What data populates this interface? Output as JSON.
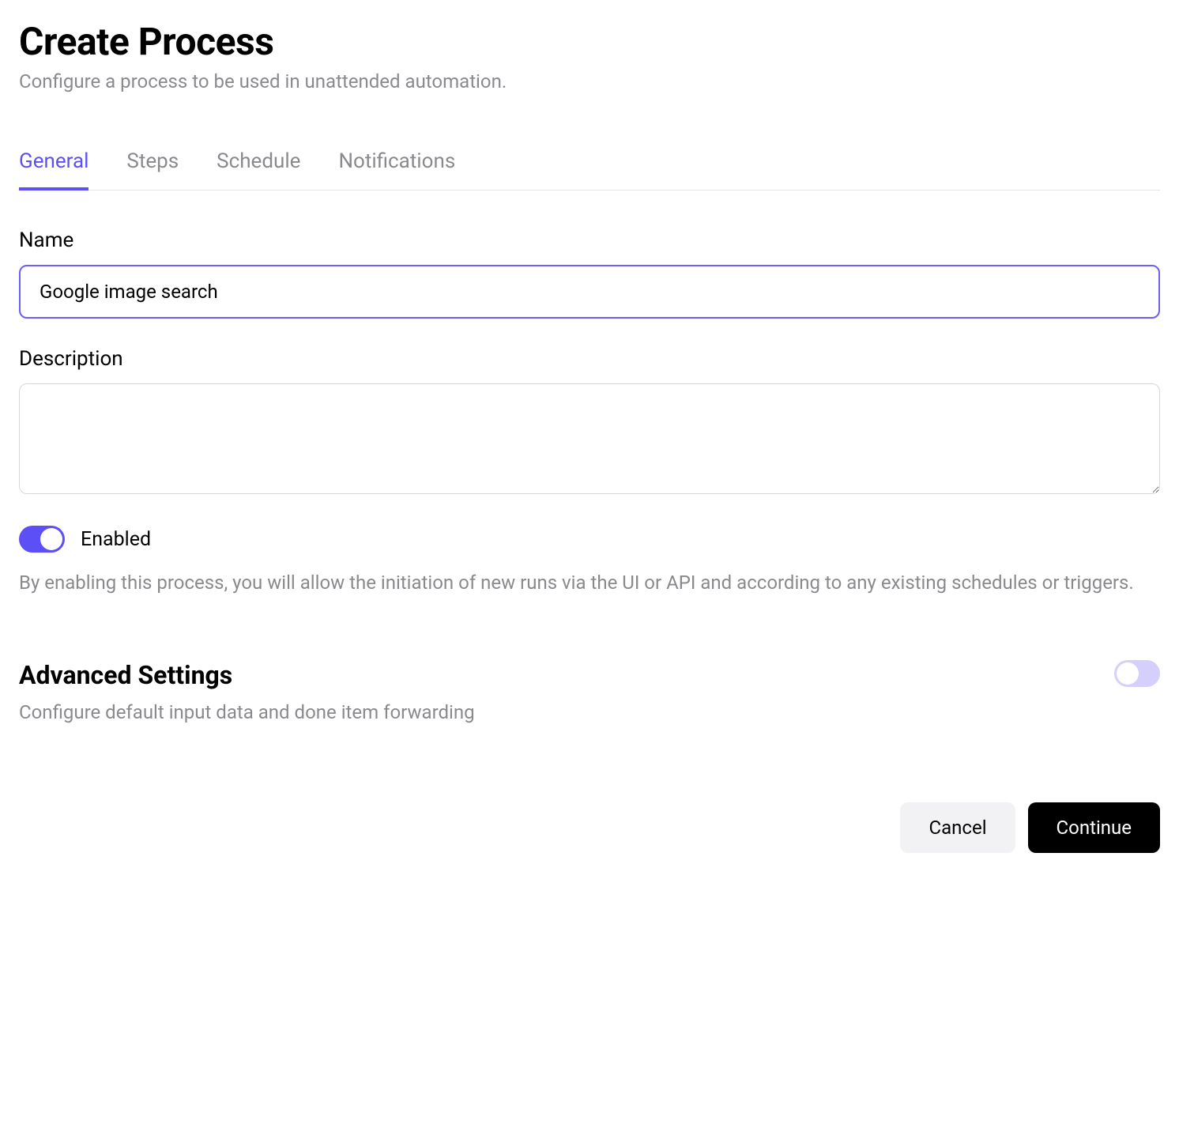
{
  "header": {
    "title": "Create Process",
    "subtitle": "Configure a process to be used in unattended automation."
  },
  "tabs": [
    {
      "label": "General",
      "active": true
    },
    {
      "label": "Steps",
      "active": false
    },
    {
      "label": "Schedule",
      "active": false
    },
    {
      "label": "Notifications",
      "active": false
    }
  ],
  "form": {
    "name": {
      "label": "Name",
      "value": "Google image search"
    },
    "description": {
      "label": "Description",
      "value": ""
    },
    "enabled": {
      "label": "Enabled",
      "state": true,
      "help": "By enabling this process, you will allow the initiation of new runs via the UI or API and according to any existing schedules or triggers."
    }
  },
  "advanced": {
    "title": "Advanced Settings",
    "subtitle": "Configure default input data and done item forwarding",
    "toggle_state": false
  },
  "footer": {
    "cancel": "Cancel",
    "continue": "Continue"
  }
}
